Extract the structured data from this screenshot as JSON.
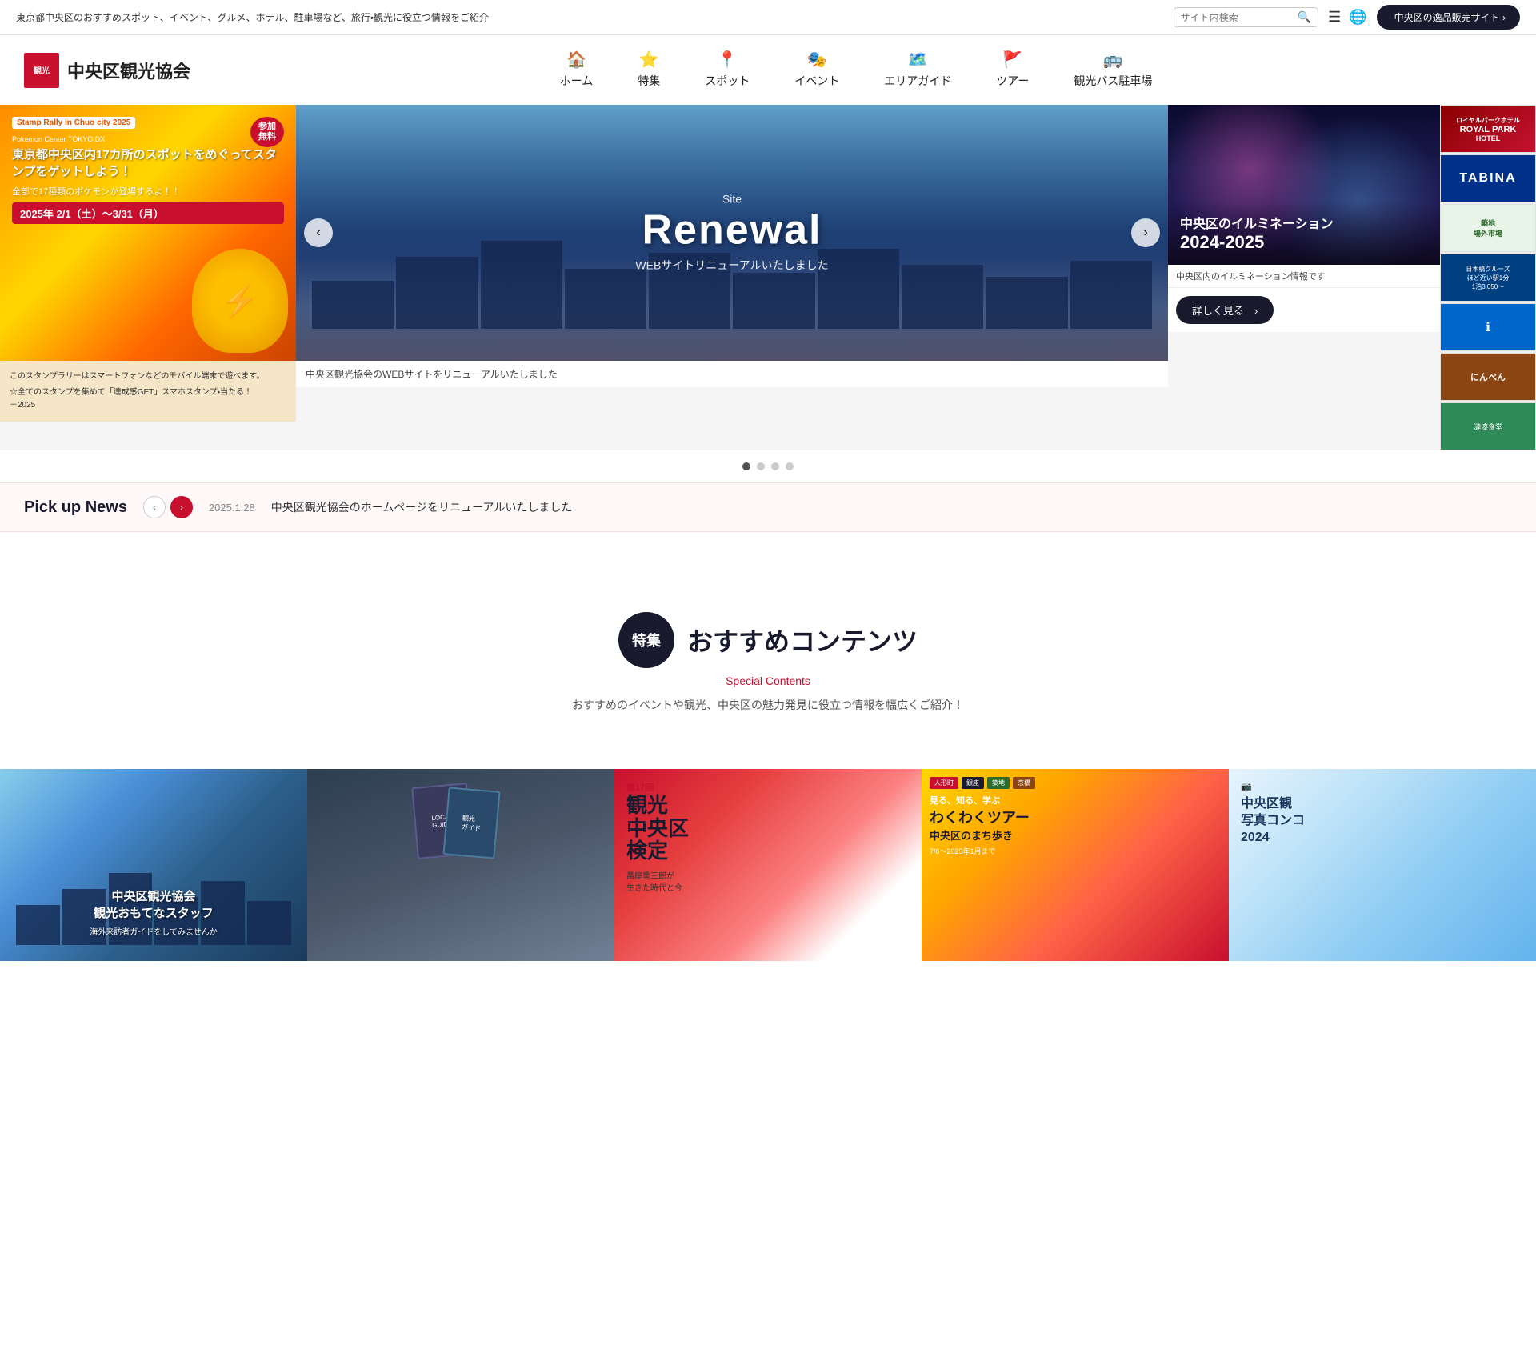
{
  "topbar": {
    "tagline": "東京都中央区のおすすめスポット、イベント、グルメ、ホテル、駐車場など、旅行・観光に役立つ情報をご紹介",
    "search_placeholder": "サイト内検索",
    "shop_btn": "中央区の逸品販売サイト"
  },
  "header": {
    "logo_text": "中央区観光協会"
  },
  "nav": {
    "items": [
      {
        "label": "ホーム",
        "icon": "🏠"
      },
      {
        "label": "特集",
        "icon": "⭐"
      },
      {
        "label": "スポット",
        "icon": "📍"
      },
      {
        "label": "イベント",
        "icon": "🎭"
      },
      {
        "label": "エリアガイド",
        "icon": "🗺️"
      },
      {
        "label": "ツアー",
        "icon": "🚩"
      },
      {
        "label": "観光バス駐車場",
        "icon": "🚌"
      }
    ]
  },
  "hero": {
    "left": {
      "stamp_rally": "Stamp Rally in Chuo city 2025",
      "pokemon_center": "Pokemon Center TOKYO DX",
      "title": "東京都中央区内17カ所のスポットをめぐってスタンプをゲットしよう！",
      "sub": "全部で17種類のポケモンが登場するよ！！",
      "date": "2025年 2/1（土）〜3/31（月）",
      "free": "参加\n無料",
      "caption": "－2025"
    },
    "center": {
      "sub": "Site",
      "title": "Renewal",
      "body": "WEBサイトリニューアルいたしました",
      "caption": "中央区観光協会のWEBサイトをリニューアルいたしました"
    },
    "right": {
      "illumination_title": "中央区のイルミネーション",
      "illumination_year": "2024-2025",
      "caption": "中央区内のイルミネーション情報です",
      "btn": "詳しく見る　›"
    },
    "ads": [
      {
        "text": "ROYAL PARK HOTEL",
        "type": "royal-park"
      },
      {
        "text": "TABINA",
        "type": "tabina"
      },
      {
        "text": "築地\n場外市場",
        "type": "map"
      },
      {
        "text": "日本橋クルーズ\nほど近い駅1分\n1泊3,050〜",
        "type": "nihon-cruise"
      },
      {
        "text": "ℹ",
        "type": "info"
      },
      {
        "text": "にんべん",
        "type": "ninben"
      },
      {
        "text": "漣漆食堂",
        "type": "hasegawa"
      }
    ]
  },
  "carousel": {
    "dots": [
      true,
      false,
      false,
      false
    ]
  },
  "pickup": {
    "label": "Pick up News",
    "prev": "‹",
    "next": "›",
    "date": "2025.1.28",
    "text": "中央区観光協会のホームページをリニューアルいたしました"
  },
  "special": {
    "badge": "特集",
    "title": "おすすめコンテンツ",
    "subtitle": "Special Contents",
    "desc": "おすすめのイベントや観光、中央区の魅力発見に役立つ情報を幅広くご紹介！",
    "cards": [
      {
        "title": "中央区観光協会\n観光おもてなスタッフ",
        "sub": "海外来訪者ガイドをしてみませんか",
        "type": "city-night"
      },
      {
        "title": "",
        "sub": "",
        "type": "local-guide"
      },
      {
        "title": "観光\n中央区\n検定",
        "num": "第17回",
        "sub": "萬屋重三郎が\n生きた時代と今",
        "type": "kanko-kentei"
      },
      {
        "title": "わくわくツアー",
        "sub": "中央区のまち歩き",
        "type": "waku-waku"
      },
      {
        "title": "中央区観\n写真コンコ\n2024",
        "sub": "",
        "type": "photo-contest"
      }
    ]
  }
}
